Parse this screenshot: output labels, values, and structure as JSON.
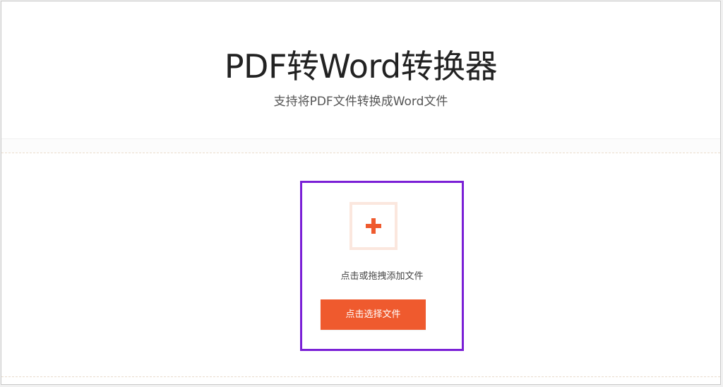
{
  "header": {
    "title": "PDF转Word转换器",
    "subtitle": "支持将PDF文件转换成Word文件"
  },
  "upload": {
    "icon": "plus-icon",
    "hint": "点击或拖拽添加文件",
    "button_label": "点击选择文件"
  },
  "colors": {
    "accent": "#ef5a2e",
    "focus_border": "#7a1fd6",
    "icon_frame": "#fbe7de"
  }
}
